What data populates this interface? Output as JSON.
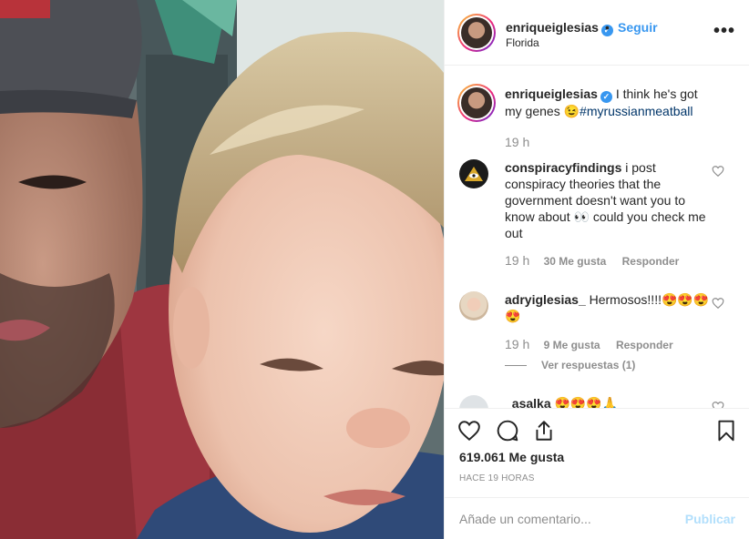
{
  "post": {
    "username": "enriqueiglesias",
    "verified_mark": "✓",
    "dot": "•",
    "follow_label": "Seguir",
    "location": "Florida",
    "more_label": "•••"
  },
  "caption": {
    "username": "enriqueiglesias",
    "text": "I think he's got my genes 😉",
    "hashtag": "#myrussianmeatball",
    "time": "19 h"
  },
  "comments": [
    {
      "username": "conspiracyfindings",
      "text": "i post conspiracy theories that the government doesn't want you to know about 👀 could you check me out",
      "time": "19 h",
      "likes": "30 Me gusta",
      "reply": "Responder"
    },
    {
      "username": "adryiglesias_",
      "text": "Hermosos!!!!😍😍😍😍",
      "time": "19 h",
      "likes": "9 Me gusta",
      "reply": "Responder",
      "view_replies": "Ver respuestas (1)"
    },
    {
      "username": "_asalka",
      "text": "😍😍😍🙏"
    }
  ],
  "actions": {
    "like_icon": "heart-icon",
    "comment_icon": "comment-icon",
    "share_icon": "share-icon",
    "save_icon": "bookmark-icon"
  },
  "likes_count": "619.061 Me gusta",
  "post_time": "HACE 19 HORAS",
  "add_comment": {
    "placeholder": "Añade un comentario...",
    "post_label": "Publicar"
  },
  "colors": {
    "link": "#3897f0",
    "muted": "#8e8e8e",
    "text": "#262626",
    "publish_disabled": "#b2dffc"
  }
}
